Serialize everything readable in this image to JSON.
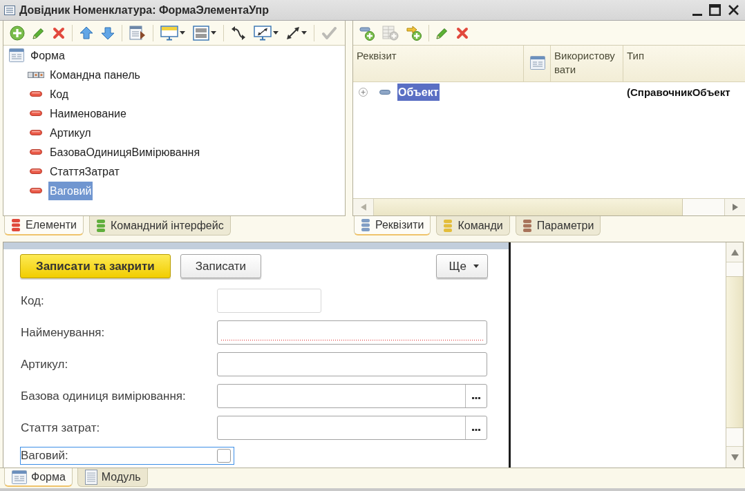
{
  "window": {
    "title": "Довідник Номенклатура: ФормаЭлементаУпр"
  },
  "elements_panel": {
    "toolbar": [
      {
        "disabled": false
      },
      {
        "disabled": false
      },
      {
        "disabled": false
      },
      {
        "disabled": false
      },
      {
        "disabled": false
      },
      {
        "disabled": false
      },
      {
        "disabled": false
      },
      {
        "disabled": false
      },
      {
        "disabled": false
      },
      {
        "disabled": false
      },
      {
        "disabled": false
      },
      {
        "disabled": true
      }
    ],
    "tree": [
      {
        "label": "Форма",
        "kind": "form",
        "selected": false,
        "children": [
          {
            "label": "Командна панель",
            "kind": "command_bar",
            "selected": false
          },
          {
            "label": "Код",
            "kind": "field",
            "selected": false
          },
          {
            "label": "Наименование",
            "kind": "field",
            "selected": false
          },
          {
            "label": "Артикул",
            "kind": "field",
            "selected": false
          },
          {
            "label": "БазоваОдиницяВимірювання",
            "kind": "field",
            "selected": false
          },
          {
            "label": "СтаттяЗатрат",
            "kind": "field",
            "selected": false
          },
          {
            "label": "Ваговий",
            "kind": "field",
            "selected": true
          }
        ]
      }
    ],
    "tabs": [
      {
        "label": "Елементи",
        "selected": true,
        "color": "#e0493c"
      },
      {
        "label": "Командний інтерфейс",
        "selected": false,
        "color": "#5fae3c"
      }
    ]
  },
  "attributes_panel": {
    "toolbar": [
      {
        "disabled": false
      },
      {
        "disabled": true
      },
      {
        "disabled": false
      },
      {
        "disabled": false
      },
      {
        "disabled": false
      }
    ],
    "columns": [
      {
        "kind": "text",
        "label": "Реквізит"
      },
      {
        "kind": "icon"
      },
      {
        "kind": "text",
        "label": "Використовувати"
      },
      {
        "kind": "text",
        "label": "Тип"
      }
    ],
    "rows": [
      {
        "name": "Объект",
        "type": "(СправочникОбъект",
        "expanded": false,
        "selected": true
      }
    ],
    "tabs": [
      {
        "label": "Реквізити",
        "selected": true,
        "color": "#7f9dc4"
      },
      {
        "label": "Команди",
        "selected": false,
        "color": "#e3bd3a"
      },
      {
        "label": "Параметри",
        "selected": false,
        "color": "#a8735a"
      }
    ]
  },
  "form_preview": {
    "buttons": [
      {
        "label": "Записати та закрити",
        "kind": "default"
      },
      {
        "label": "Записати",
        "kind": "normal"
      },
      {
        "label": "Ще",
        "kind": "menu"
      }
    ],
    "fields": [
      {
        "label": "Код:",
        "kind": "short",
        "required": false,
        "focused": false
      },
      {
        "label": "Найменування:",
        "kind": "text",
        "required": true,
        "focused": false
      },
      {
        "label": "Артикул:",
        "kind": "text",
        "required": false,
        "focused": false
      },
      {
        "label": "Базова одиниця вимірювання:",
        "kind": "choice",
        "required": false,
        "focused": false
      },
      {
        "label": "Стаття затрат:",
        "kind": "choice",
        "required": false,
        "focused": false
      },
      {
        "label": "Ваговий:",
        "kind": "checkbox",
        "checked": false,
        "focused": true
      }
    ]
  },
  "bottom_tabs": [
    {
      "label": "Форма",
      "kind": "form",
      "selected": true
    },
    {
      "label": "Модуль",
      "kind": "module",
      "selected": false
    }
  ]
}
